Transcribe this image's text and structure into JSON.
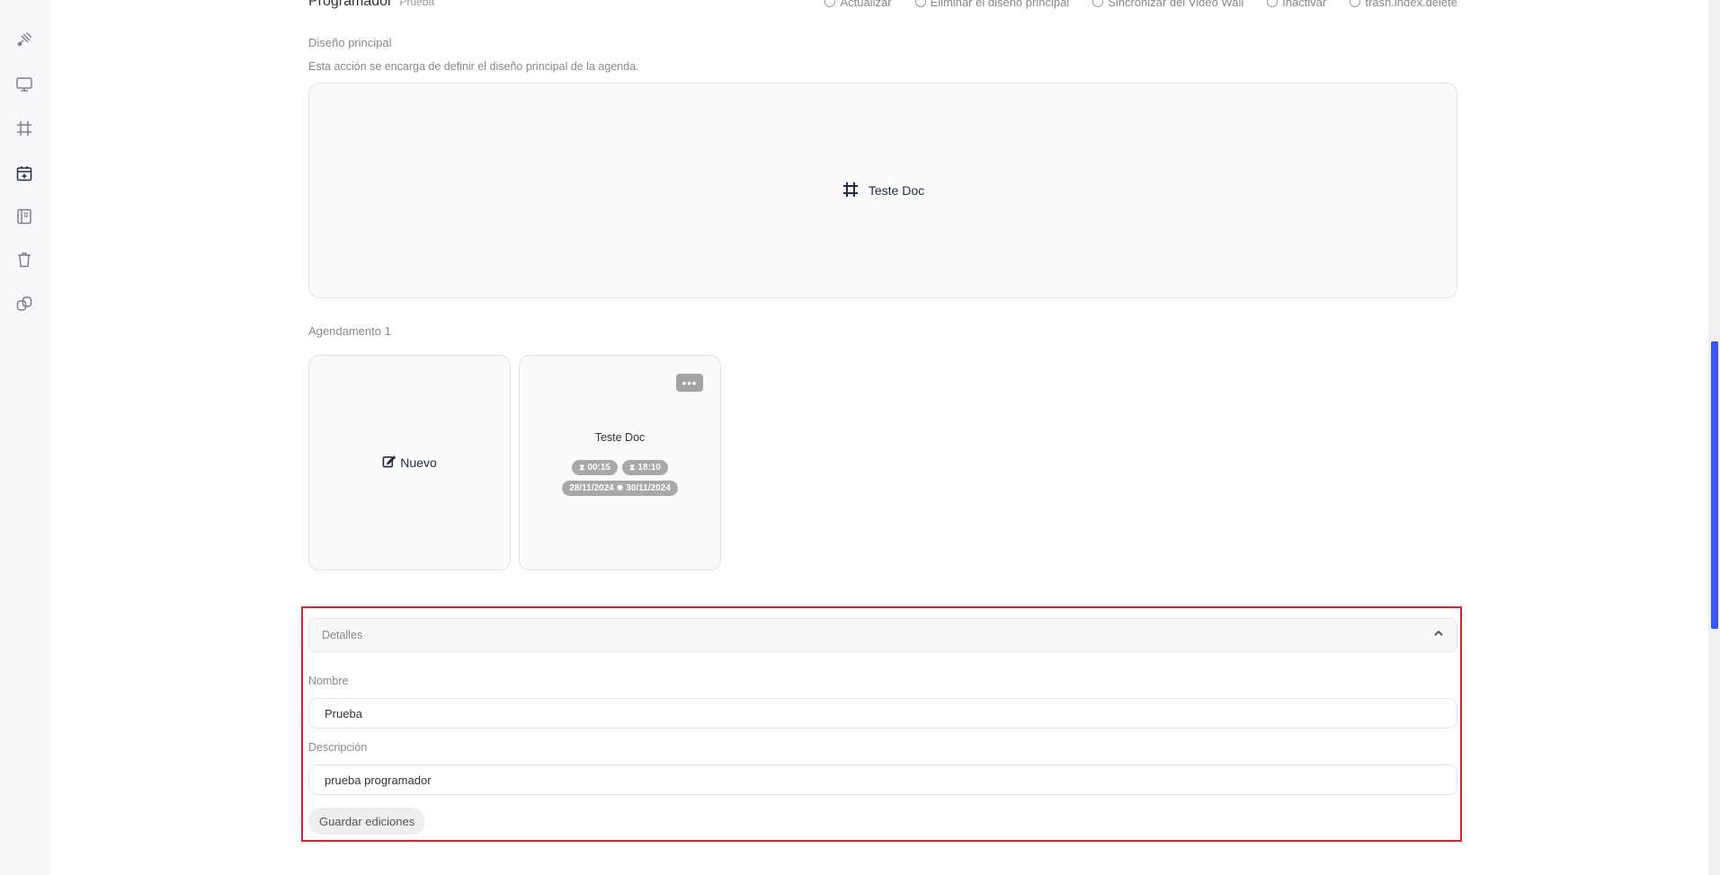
{
  "header": {
    "title": "Programador",
    "subtitle": "Prueba",
    "actions": [
      {
        "label": "Actualizar",
        "icon": "refresh-icon"
      },
      {
        "label": "Eliminar el diseño principal",
        "icon": "trash-icon"
      },
      {
        "label": "Sincronizar del Video Wall",
        "icon": "sync-icon"
      },
      {
        "label": "Inactivar",
        "icon": "eye-off-icon"
      },
      {
        "label": "trash.index.delete",
        "icon": "trash-icon"
      }
    ]
  },
  "sidebar": {
    "items": [
      {
        "name": "satellite-icon"
      },
      {
        "name": "monitor-icon"
      },
      {
        "name": "frame-icon"
      },
      {
        "name": "calendar-plus-icon",
        "active": true
      },
      {
        "name": "notebook-icon"
      },
      {
        "name": "trash-icon"
      },
      {
        "name": "link-icon"
      }
    ]
  },
  "main_design": {
    "label": "Diseño principal",
    "description": "Esta acción se encarga de definir el diseño principal de la agenda.",
    "item_name": "Teste Doc"
  },
  "schedule": {
    "label": "Agendamento 1",
    "new_label": "Nuevo",
    "more_label": "•••",
    "item": {
      "title": "Teste Doc",
      "start_time": "00:15",
      "end_time": "18:10",
      "start_date": "28/11/2024",
      "end_date": "30/11/2024"
    }
  },
  "details": {
    "title": "Detalles",
    "name_label": "Nombre",
    "name_value": "Prueba",
    "description_label": "Descripción",
    "description_value": "prueba programador",
    "save_label": "Guardar ediciones"
  },
  "colors": {
    "highlight": "#e31e24",
    "accent": "#3a55f0",
    "badge": "#a8a8a8"
  }
}
